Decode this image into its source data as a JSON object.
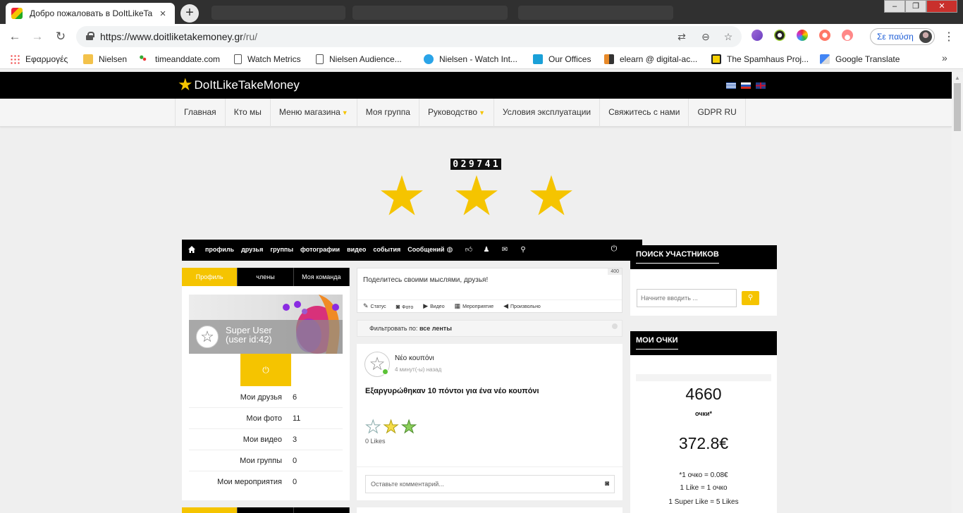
{
  "browser": {
    "tab_title": "Добро пожаловать в DoItLikeTa",
    "new_tab": "+",
    "url_host": "https://www.doitliketakemoney.gr",
    "url_path": "/ru/",
    "profile_label": "Σε παύση"
  },
  "bookmarks": [
    {
      "label": "Εφαρμογές",
      "icon": "apps-icon"
    },
    {
      "label": "Nielsen",
      "icon": "folder-icon"
    },
    {
      "label": "timeanddate.com",
      "icon": "timeanddate-icon"
    },
    {
      "label": "Watch Metrics",
      "icon": "page-icon"
    },
    {
      "label": "Nielsen Audience...",
      "icon": "page-icon"
    },
    {
      "label": "Nielsen - Watch Int...",
      "icon": "nielsen-cloud-icon"
    },
    {
      "label": "Our Offices",
      "icon": "n-logo-icon"
    },
    {
      "label": "elearn @ digital-ac...",
      "icon": "elearn-icon"
    },
    {
      "label": "The Spamhaus Proj...",
      "icon": "spamhaus-icon"
    },
    {
      "label": "Google Translate",
      "icon": "google-translate-icon"
    }
  ],
  "site": {
    "logo": "DoItLikeTakeMoney",
    "menu": [
      {
        "label": "Главная",
        "dropdown": false
      },
      {
        "label": "Кто мы",
        "dropdown": false
      },
      {
        "label": "Меню магазина",
        "dropdown": true
      },
      {
        "label": "Моя группа",
        "dropdown": false
      },
      {
        "label": "Руководство",
        "dropdown": true
      },
      {
        "label": "Условия эксплуатации",
        "dropdown": false
      },
      {
        "label": "Свяжитесь с нами",
        "dropdown": false
      },
      {
        "label": "GDPR RU",
        "dropdown": false
      }
    ]
  },
  "hero": {
    "counter_digits": [
      "0",
      "2",
      "9",
      "7",
      "4",
      "1"
    ],
    "star_color": "#f5c400"
  },
  "community": {
    "nav": [
      "профиль",
      "друзья",
      "группы",
      "фотографии",
      "видео",
      "события",
      "Сообщений"
    ],
    "profile_tabs": [
      "Профиль",
      "члены",
      "Моя команда"
    ],
    "user_name": "Super User",
    "user_id": "(user id:42)",
    "stats": [
      {
        "label": "Мои друзья",
        "value": "6"
      },
      {
        "label": "Мои фото",
        "value": "11"
      },
      {
        "label": "Мои видео",
        "value": "3"
      },
      {
        "label": "Мои группы",
        "value": "0"
      },
      {
        "label": "Мои мероприятия",
        "value": "0"
      }
    ]
  },
  "feed": {
    "composer_placeholder": "Поделитесь своими мыслями, друзья!",
    "char_limit": "400",
    "actions": [
      "Статус",
      "Фото",
      "Видео",
      "Мероприятие",
      "Произвольно"
    ],
    "filter_prefix": "Фильтровать по:",
    "filter_value": "все ленты",
    "post": {
      "title": "Νέο κουπόνι",
      "time": "4 минут(-ы) назад",
      "body": "Εξαργυρώθηκαν 10 πόντοι για ένα νέο κουπόνι",
      "likes": "0 Likes"
    },
    "comment_placeholder": "Оставьте комментарий..."
  },
  "sidebar": {
    "search_title": "ПОИСК УЧАСТНИКОВ",
    "search_placeholder": "Начните вводить ...",
    "points_title": "МОИ ОЧКИ",
    "points": "4660",
    "points_label": "очки*",
    "money": "372.8€",
    "rate1": "*1 очко = 0.08€",
    "rate2": "1 Like = 1 очко",
    "rate3": "1 Super Like = 5 Likes"
  },
  "colors": {
    "accent": "#f5c400",
    "header": "#000000",
    "online": "#5bc236"
  }
}
